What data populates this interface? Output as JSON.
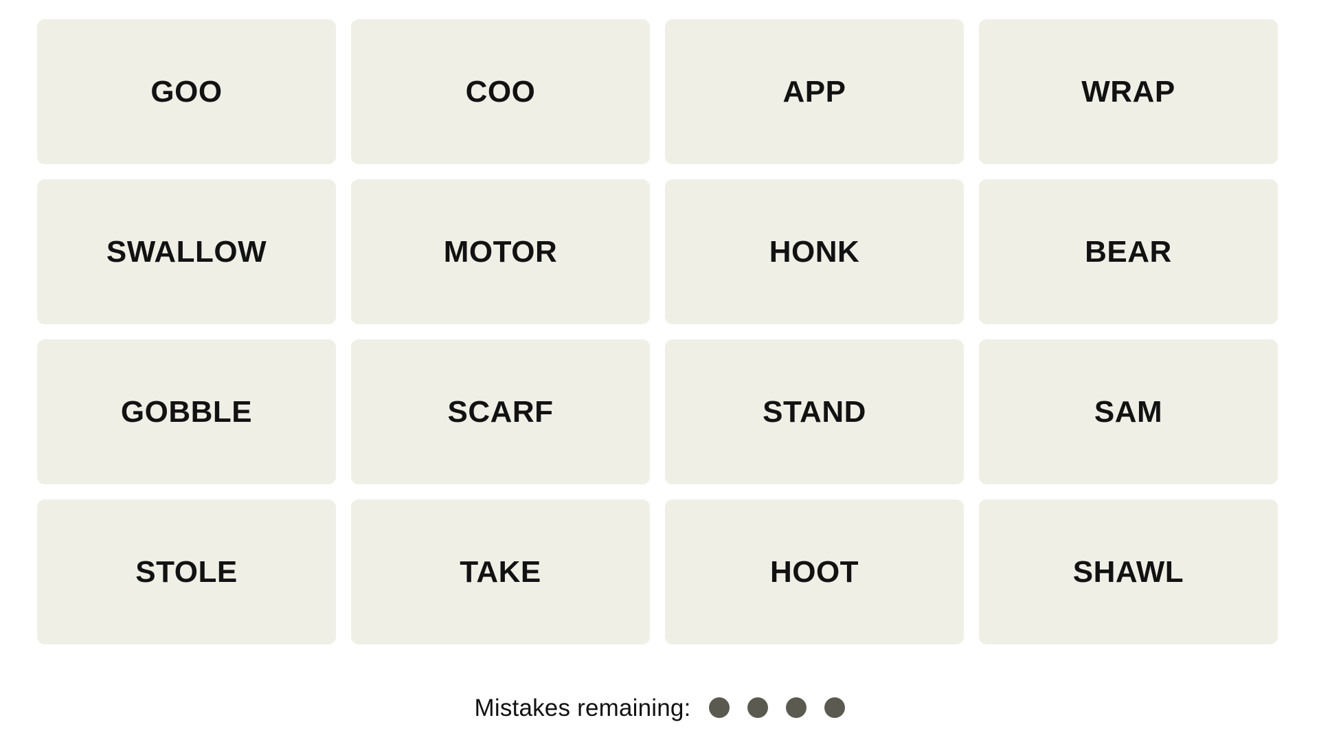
{
  "app": {
    "name": "Connections",
    "background_color": "#ffffff"
  },
  "board": {
    "rows": 4,
    "columns": 4,
    "tile_color": "#efefe6",
    "tile_text_color": "#121212",
    "tiles": [
      {
        "label": "GOO",
        "row": 1,
        "col": 1,
        "selected": false
      },
      {
        "label": "COO",
        "row": 1,
        "col": 2,
        "selected": false
      },
      {
        "label": "APP",
        "row": 1,
        "col": 3,
        "selected": false
      },
      {
        "label": "WRAP",
        "row": 1,
        "col": 4,
        "selected": false
      },
      {
        "label": "SWALLOW",
        "row": 2,
        "col": 1,
        "selected": false
      },
      {
        "label": "MOTOR",
        "row": 2,
        "col": 2,
        "selected": false
      },
      {
        "label": "HONK",
        "row": 2,
        "col": 3,
        "selected": false
      },
      {
        "label": "BEAR",
        "row": 2,
        "col": 4,
        "selected": false
      },
      {
        "label": "GOBBLE",
        "row": 3,
        "col": 1,
        "selected": false
      },
      {
        "label": "SCARF",
        "row": 3,
        "col": 2,
        "selected": false
      },
      {
        "label": "STAND",
        "row": 3,
        "col": 3,
        "selected": false
      },
      {
        "label": "SAM",
        "row": 3,
        "col": 4,
        "selected": false
      },
      {
        "label": "STOLE",
        "row": 4,
        "col": 1,
        "selected": false
      },
      {
        "label": "TAKE",
        "row": 4,
        "col": 2,
        "selected": false
      },
      {
        "label": "HOOT",
        "row": 4,
        "col": 3,
        "selected": false
      },
      {
        "label": "SHAWL",
        "row": 4,
        "col": 4,
        "selected": false
      }
    ]
  },
  "mistakes": {
    "label": "Mistakes remaining:",
    "remaining": 4,
    "dot_color": "#5a5a50",
    "dots": [
      "dot",
      "dot",
      "dot",
      "dot"
    ]
  }
}
